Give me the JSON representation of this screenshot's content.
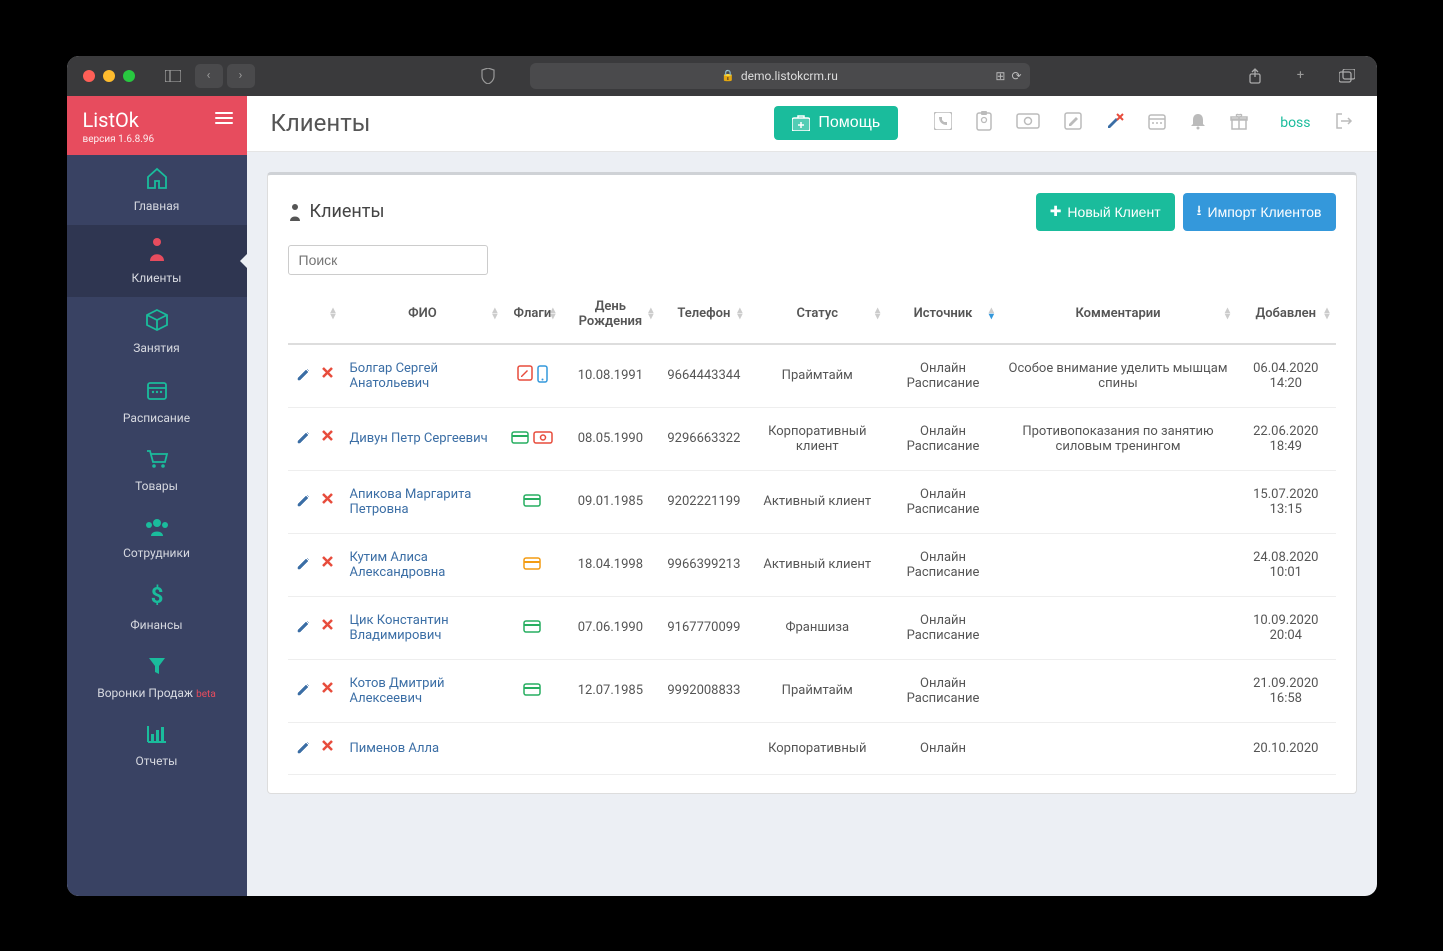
{
  "browser": {
    "url": "demo.listokcrm.ru"
  },
  "brand": {
    "name": "ListOk",
    "version": "версия 1.6.8.96"
  },
  "sidebar": {
    "items": [
      {
        "label": "Главная",
        "icon": "home"
      },
      {
        "label": "Клиенты",
        "icon": "person",
        "active": true
      },
      {
        "label": "Занятия",
        "icon": "box"
      },
      {
        "label": "Расписание",
        "icon": "calendar"
      },
      {
        "label": "Товары",
        "icon": "cart"
      },
      {
        "label": "Сотрудники",
        "icon": "users"
      },
      {
        "label": "Финансы",
        "icon": "dollar"
      },
      {
        "label": "Воронки Продаж",
        "icon": "funnel",
        "beta": "beta"
      },
      {
        "label": "Отчеты",
        "icon": "chart"
      }
    ]
  },
  "header": {
    "title": "Клиенты",
    "help": "Помощь",
    "user": "boss"
  },
  "panel": {
    "title": "Клиенты",
    "new_btn": "Новый Клиент",
    "import_btn": "Импорт Клиентов",
    "search_placeholder": "Поиск",
    "columns": [
      "",
      "ФИО",
      "Флаги",
      "День Рождения",
      "Телефон",
      "Статус",
      "Источник",
      "Комментарии",
      "Добавлен"
    ],
    "rows": [
      {
        "name": "Болгар Сергей Анатольевич",
        "flags": [
          "edit",
          "mobile"
        ],
        "dob": "10.08.1991",
        "phone": "9664443344",
        "status": "Праймтайм",
        "source": "Онлайн Расписание",
        "comment": "Особое внимание уделить мышцам спины",
        "added": "06.04.2020 14:20"
      },
      {
        "name": "Дивун Петр Сергеевич",
        "flags": [
          "card-g",
          "money"
        ],
        "dob": "08.05.1990",
        "phone": "9296663322",
        "status": "Корпоративный клиент",
        "source": "Онлайн Расписание",
        "comment": "Противопоказания по занятию силовым тренингом",
        "added": "22.06.2020 18:49"
      },
      {
        "name": "Апикова Маргарита Петровна",
        "flags": [
          "card-g"
        ],
        "dob": "09.01.1985",
        "phone": "9202221199",
        "status": "Активный клиент",
        "source": "Онлайн Расписание",
        "comment": "",
        "added": "15.07.2020 13:15"
      },
      {
        "name": "Кутим Алиса Александровна",
        "flags": [
          "card-o"
        ],
        "dob": "18.04.1998",
        "phone": "9966399213",
        "status": "Активный клиент",
        "source": "Онлайн Расписание",
        "comment": "",
        "added": "24.08.2020 10:01"
      },
      {
        "name": "Цик Константин Владимирович",
        "flags": [
          "card-g"
        ],
        "dob": "07.06.1990",
        "phone": "9167770099",
        "status": "Франшиза",
        "source": "Онлайн Расписание",
        "comment": "",
        "added": "10.09.2020 20:04"
      },
      {
        "name": "Котов Дмитрий Алексеевич",
        "flags": [
          "card-g"
        ],
        "dob": "12.07.1985",
        "phone": "9992008833",
        "status": "Праймтайм",
        "source": "Онлайн Расписание",
        "comment": "",
        "added": "21.09.2020 16:58"
      },
      {
        "name": "Пименов Алла",
        "flags": [],
        "dob": "",
        "phone": "",
        "status": "Корпоративный",
        "source": "Онлайн",
        "comment": "",
        "added": "20.10.2020"
      }
    ]
  }
}
